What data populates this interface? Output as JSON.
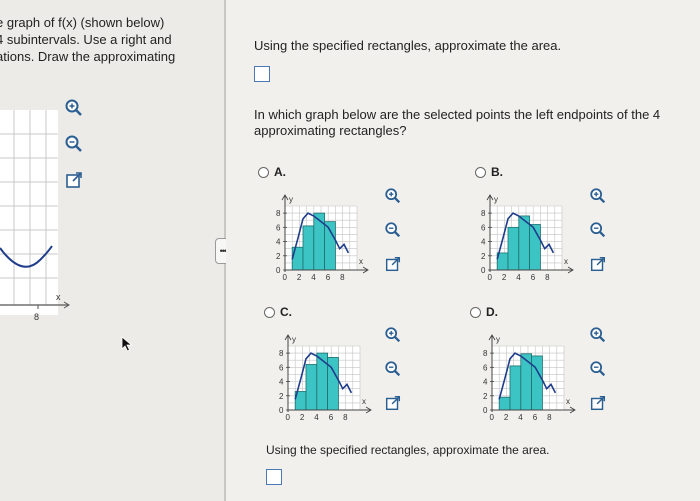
{
  "left_panel": {
    "lines": [
      "e graph of f(x) (shown below)",
      "4 subintervals. Use a right and",
      "ations. Draw the approximating"
    ],
    "axis_x_label": "x",
    "tick_label": "8"
  },
  "collapse_handle": {
    "label": "•••••"
  },
  "main": {
    "prompt_top": "Using the specified rectangles, approximate the area.",
    "question_line1": "In which graph below are the selected points the left endpoints of the 4",
    "question_line2": "approximating rectangles?",
    "prompt_bottom": "Using the specified rectangles, approximate the area."
  },
  "options": [
    {
      "label": "A."
    },
    {
      "label": "B."
    },
    {
      "label": "C."
    },
    {
      "label": "D."
    }
  ],
  "graph_labels": {
    "y": "y",
    "x": "x",
    "y_ticks": [
      "8",
      "6",
      "4",
      "2",
      "0"
    ],
    "x_ticks": [
      "0",
      "2",
      "4",
      "6",
      "8"
    ]
  },
  "colors": {
    "rect_fill": "#3cc4c4",
    "curve": "#1f3d8a",
    "zoom_icon": "#2c5f91",
    "answer_border": "#4a79b6"
  },
  "icons": [
    "zoom-in-icon",
    "zoom-out-icon",
    "popout-icon"
  ]
}
